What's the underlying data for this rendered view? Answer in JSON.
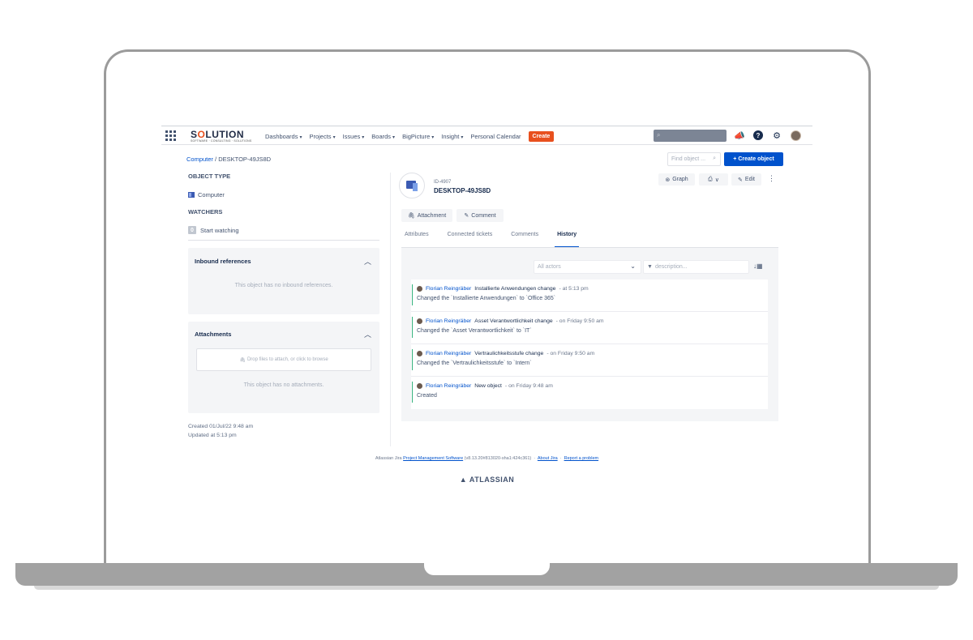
{
  "nav": {
    "logo": "SOLUTION",
    "logo_prefix": "S",
    "logo_o": "O",
    "logo_rest": "LUTION",
    "logo_tagline": "SOFTWARE · CONSULTING · SOLUTIONS",
    "items": [
      "Dashboards",
      "Projects",
      "Issues",
      "Boards",
      "BigPicture",
      "Insight",
      "Personal Calendar"
    ],
    "create_label": "Create",
    "search_icon": "search-icon",
    "brand_color": "#e8501e"
  },
  "breadcrumb": {
    "parent": "Computer",
    "separator": " / ",
    "current": "DESKTOP-49JS8D"
  },
  "find_object": {
    "placeholder": "Find object ..."
  },
  "create_object_label": "+ Create object",
  "left": {
    "object_type_title": "OBJECT TYPE",
    "object_type_value": "Computer",
    "watchers_title": "WATCHERS",
    "watchers_count": "0",
    "start_watching": "Start watching",
    "inbound": {
      "title": "Inbound references",
      "empty": "This object has no inbound references."
    },
    "attachments": {
      "title": "Attachments",
      "dropzone": "Drop files to attach, or click to browse",
      "empty": "This object has no attachments."
    },
    "created": "Created 01/Jul/22 9:48 am",
    "updated": "Updated at 5:13 pm"
  },
  "object": {
    "id": "ID-4907",
    "name": "DESKTOP-49JS8D"
  },
  "toolbar": {
    "graph": "Graph",
    "edit": "Edit"
  },
  "actions": {
    "attachment": "Attachment",
    "comment": "Comment"
  },
  "tabs": [
    "Attributes",
    "Connected tickets",
    "Comments",
    "History"
  ],
  "history": {
    "actors_placeholder": "All actors",
    "description_placeholder": "description...",
    "entries": [
      {
        "user": "Florian Reingräber",
        "type": "Installierte Anwendungen change",
        "time": "- at 5:13 pm",
        "detail": "Changed the `Installierte Anwendungen` to `Office 365`"
      },
      {
        "user": "Florian Reingräber",
        "type": "Asset Verantwortlichkeit change",
        "time": "- on Friday 9:50 am",
        "detail": "Changed the `Asset Verantwortlichkeit` to `IT`"
      },
      {
        "user": "Florian Reingräber",
        "type": "Vertraulichkeitsstufe change",
        "time": "- on Friday 9:50 am",
        "detail": "Changed the `Vertraulichkeitsstufe` to `Intern`"
      },
      {
        "user": "Florian Reingräber",
        "type": "New object",
        "time": "- on Friday 9:48 am",
        "detail": "Created"
      }
    ]
  },
  "footer": {
    "prefix": "Atlassian Jira",
    "link1": "Project Management Software",
    "version": "(v8.13.20#813020-sha1:424c361)",
    "link2": "About Jira",
    "link3": "Report a problem",
    "brand": "ATLASSIAN"
  }
}
